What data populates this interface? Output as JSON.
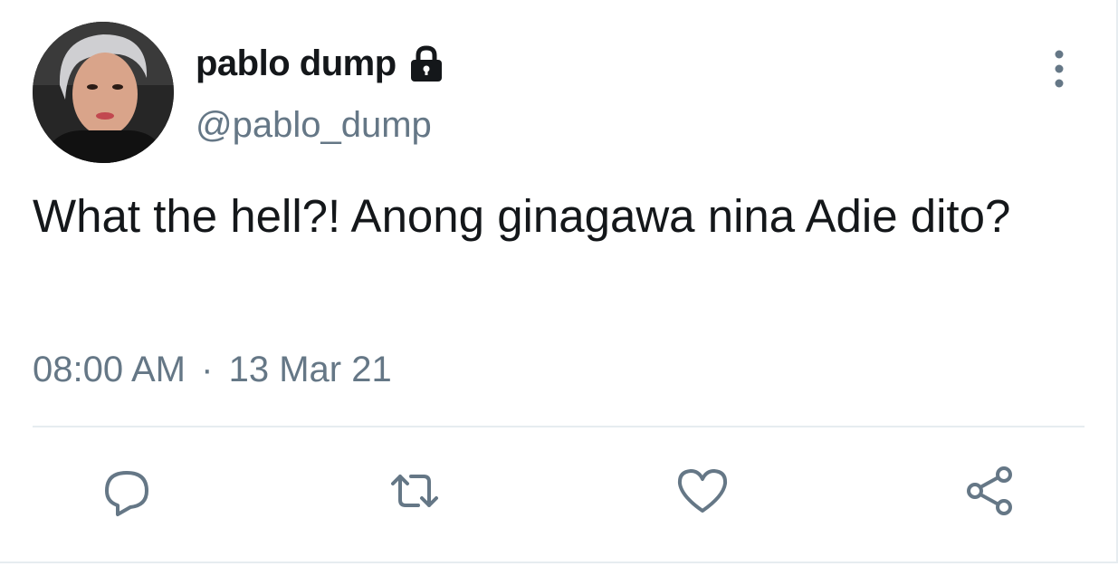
{
  "tweet": {
    "display_name": "pablo dump",
    "handle": "@pablo_dump",
    "text": "What the hell?! Anong ginagawa nina Adie dito?",
    "time": "08:00 AM",
    "separator": "·",
    "date": "13 Mar 21",
    "protected": true
  },
  "icons": {
    "lock": "lock-icon",
    "more": "more-vertical-icon",
    "reply": "reply-icon",
    "retweet": "retweet-icon",
    "like": "heart-icon",
    "share": "share-icon"
  },
  "colors": {
    "text_primary": "#14171a",
    "text_secondary": "#657786",
    "divider": "#e6ecf0",
    "icon": "#657786"
  }
}
